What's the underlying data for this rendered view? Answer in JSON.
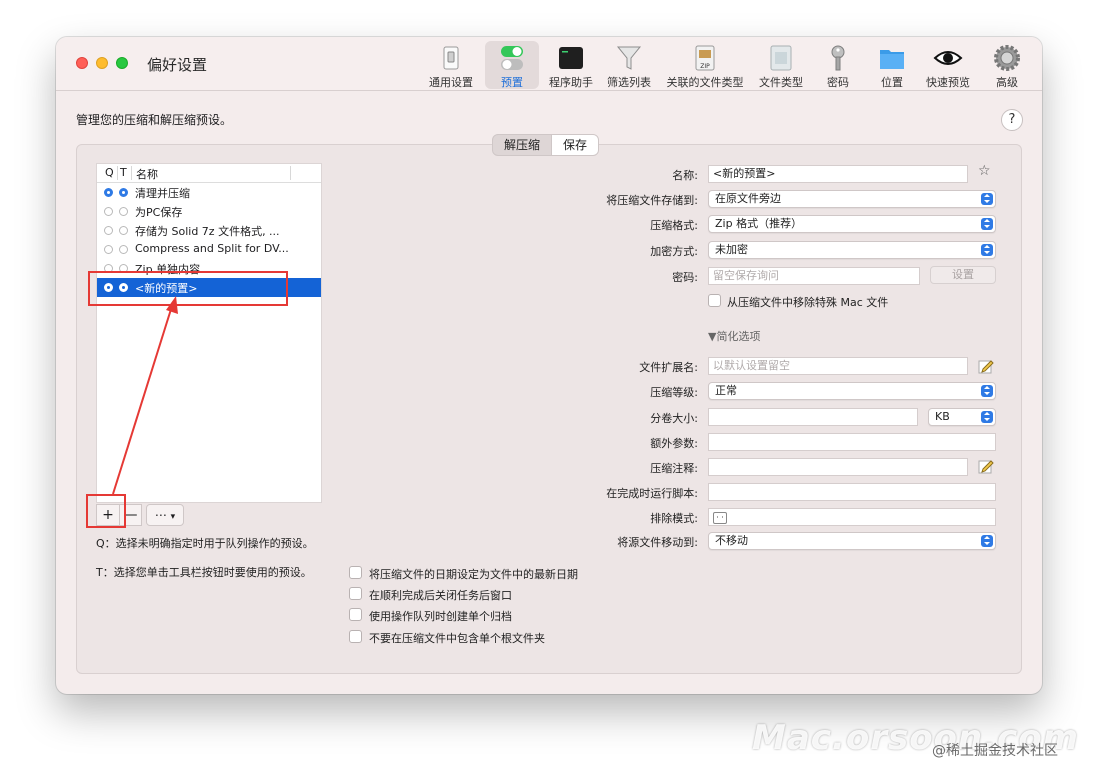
{
  "window": {
    "title": "偏好设置"
  },
  "toolbar": {
    "items": [
      {
        "label": "通用设置",
        "icon": "switch-icon"
      },
      {
        "label": "预置",
        "icon": "toggles-icon"
      },
      {
        "label": "程序助手",
        "icon": "terminal-icon"
      },
      {
        "label": "筛选列表",
        "icon": "funnel-icon"
      },
      {
        "label": "关联的文件类型",
        "icon": "zip-archive-icon"
      },
      {
        "label": "文件类型",
        "icon": "document-icon"
      },
      {
        "label": "密码",
        "icon": "key-icon"
      },
      {
        "label": "位置",
        "icon": "folder-icon"
      },
      {
        "label": "快速预览",
        "icon": "eye-icon"
      },
      {
        "label": "高级",
        "icon": "gear-icon"
      }
    ],
    "selected": "预置"
  },
  "subtitle": "管理您的压缩和解压缩预设。",
  "help_label": "?",
  "segmented": {
    "left": "解压缩",
    "right": "保存"
  },
  "preset_list": {
    "headers": {
      "q": "Q",
      "t": "T",
      "name": "名称"
    },
    "rows": [
      {
        "name": "清理并压缩",
        "q": true,
        "t": true
      },
      {
        "name": "为PC保存",
        "q": false,
        "t": false
      },
      {
        "name": "存储为 Solid 7z 文件格式, ...",
        "q": false,
        "t": false
      },
      {
        "name": "Compress and Split for DV...",
        "q": false,
        "t": false
      },
      {
        "name": "Zip 单独内容",
        "q": false,
        "t": false
      },
      {
        "name": "<新的预置>",
        "q": true,
        "t": true,
        "selected": true
      }
    ]
  },
  "list_tools": {
    "add": "+",
    "remove": "—",
    "more": "⋯"
  },
  "notes": {
    "q": "Q：选择未明确指定时用于队列操作的预设。",
    "t": "T：选择您单击工具栏按钮时要使用的预设。"
  },
  "form": {
    "name_label": "名称:",
    "name_value": "<新的预置>",
    "save_to_label": "将压缩文件存储到:",
    "save_to_value": "在原文件旁边",
    "format_label": "压缩格式:",
    "format_value": "Zip 格式（推荐）",
    "encryption_label": "加密方式:",
    "encryption_value": "未加密",
    "password_label": "密码:",
    "password_placeholder": "留空保存询问",
    "set_button": "设置",
    "remove_mac_label": "从压缩文件中移除特殊 Mac 文件",
    "simplify_label": "▼简化选项",
    "extension_label": "文件扩展名:",
    "extension_placeholder": "以默认设置留空",
    "level_label": "压缩等级:",
    "level_value": "正常",
    "split_label": "分卷大小:",
    "split_unit": "KB",
    "extra_label": "额外参数:",
    "comment_label": "压缩注释:",
    "script_label": "在完成时运行脚本:",
    "exclude_label": "排除模式:",
    "move_source_label": "将源文件移动到:",
    "move_source_value": "不移动"
  },
  "checkboxes": [
    {
      "label": "将压缩文件的日期设定为文件中的最新日期",
      "checked": false
    },
    {
      "label": "在顺利完成后关闭任务后窗口",
      "checked": false
    },
    {
      "label": "使用操作队列时创建单个归档",
      "checked": false
    },
    {
      "label": "不要在压缩文件中包含单个根文件夹",
      "checked": false
    }
  ],
  "watermark": {
    "site": "Mac.orsoon.com",
    "credit": "@稀土掘金技术社区"
  },
  "colors": {
    "accent": "#1463d6",
    "annotation": "#e53935",
    "window_bg": "#f4ecec"
  }
}
